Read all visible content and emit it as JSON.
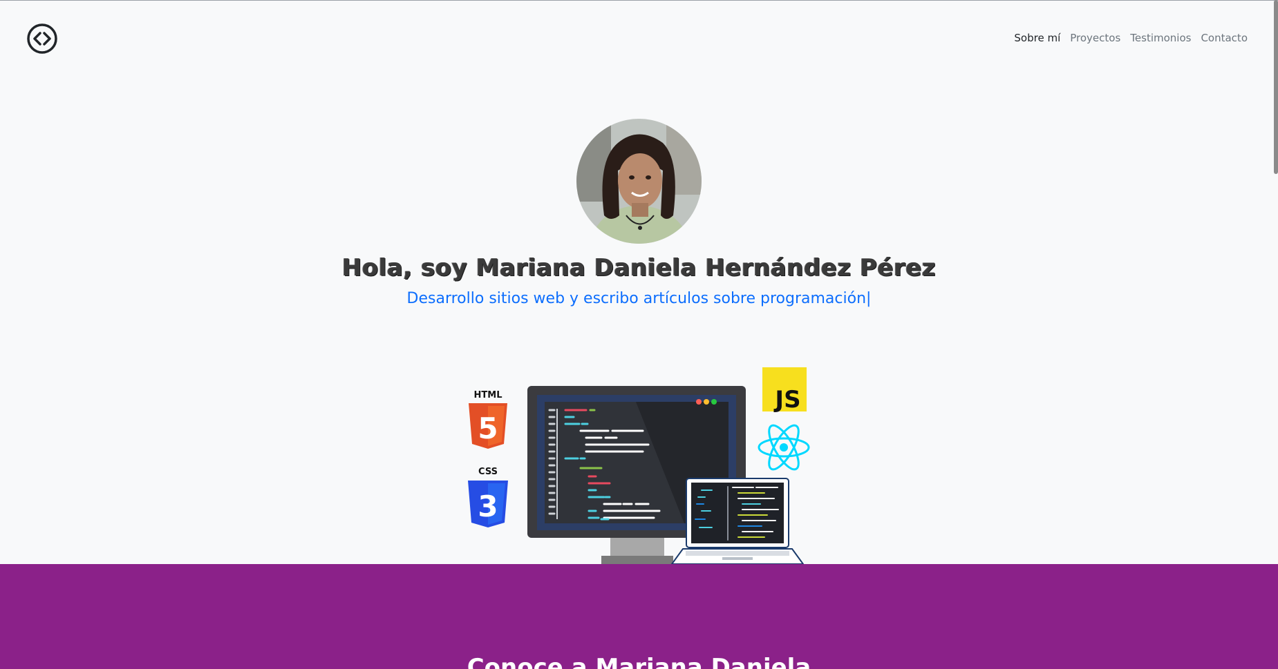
{
  "nav": {
    "logo_icon": "code-brackets-icon",
    "items": [
      {
        "label": "Sobre mí",
        "active": true
      },
      {
        "label": "Proyectos",
        "active": false
      },
      {
        "label": "Testimonios",
        "active": false
      },
      {
        "label": "Contacto",
        "active": false
      }
    ]
  },
  "hero": {
    "title": "Hola, soy Mariana Daniela Hernández Pérez",
    "subtitle": "Desarrollo sitios web y escribo artículos sobre programación",
    "caret": "|",
    "illustration": {
      "html_badge": "HTML",
      "html_number": "5",
      "css_badge": "CSS",
      "css_number": "3",
      "js_badge": "JS"
    }
  },
  "band": {
    "color": "#8b2189",
    "title": "Conoce a Mariana Daniela"
  },
  "colors": {
    "accent": "#0d6efd",
    "html": "#e34f26",
    "css": "#264de4",
    "js": "#f7df1e",
    "react": "#00d8ff"
  }
}
